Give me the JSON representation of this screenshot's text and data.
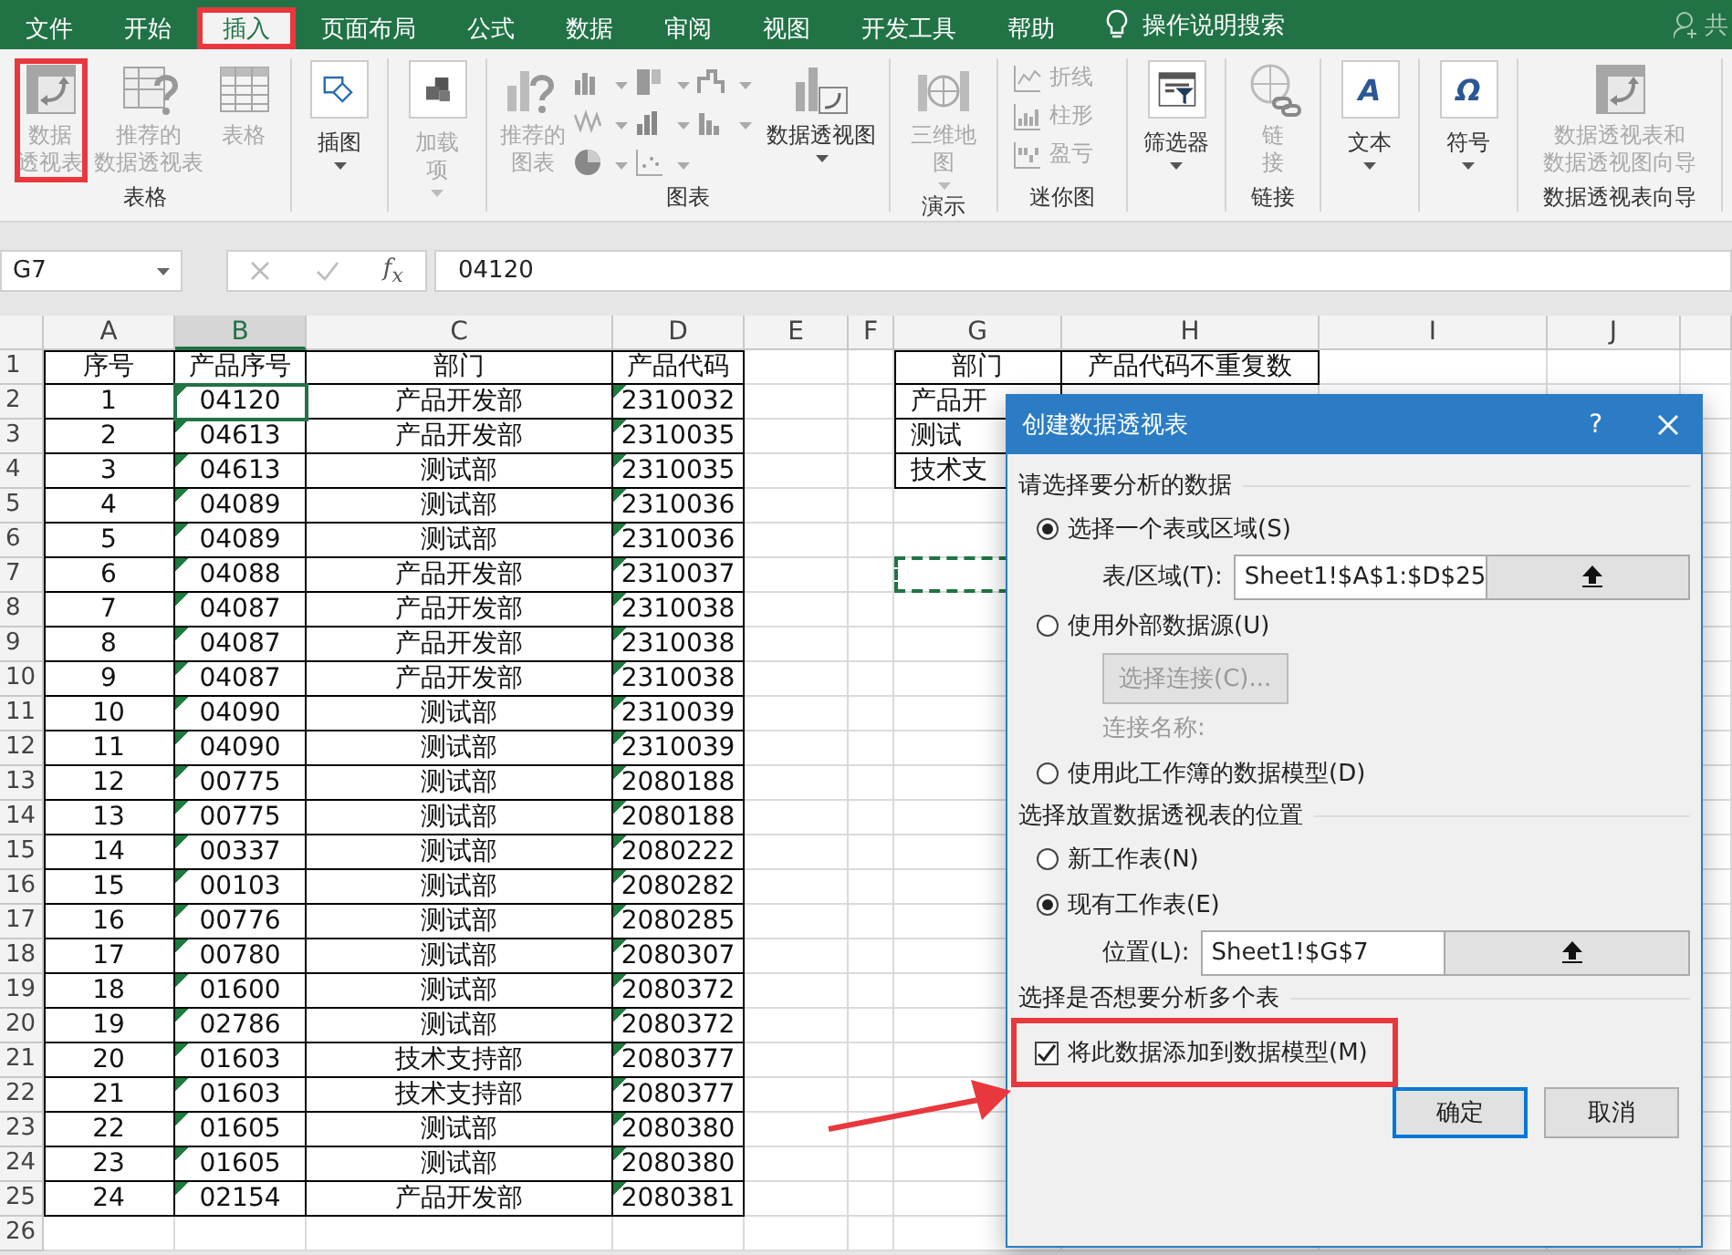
{
  "menu": {
    "tabs": [
      {
        "label": "文件",
        "selected": false
      },
      {
        "label": "开始",
        "selected": false
      },
      {
        "label": "插入",
        "selected": true,
        "annotated": true
      },
      {
        "label": "页面布局",
        "selected": false
      },
      {
        "label": "公式",
        "selected": false
      },
      {
        "label": "数据",
        "selected": false
      },
      {
        "label": "审阅",
        "selected": false
      },
      {
        "label": "视图",
        "selected": false
      },
      {
        "label": "开发工具",
        "selected": false
      },
      {
        "label": "帮助",
        "selected": false
      }
    ],
    "search": "操作说明搜索",
    "share": "共"
  },
  "ribbon": {
    "groups": [
      {
        "label": "表格",
        "items": [
          {
            "kind": "large",
            "lines": [
              "数据",
              "透视表"
            ],
            "disabled": true,
            "annotated": true
          },
          {
            "kind": "large",
            "lines": [
              "推荐的",
              "数据透视表"
            ],
            "disabled": true
          },
          {
            "kind": "large",
            "lines": [
              "表格"
            ],
            "disabled": true
          }
        ]
      },
      {
        "items": [
          {
            "kind": "large",
            "lines": [
              "插图"
            ],
            "disabled": false,
            "dropdown": true,
            "framed": true
          }
        ]
      },
      {
        "items": [
          {
            "kind": "large",
            "lines": [
              "加载",
              "项"
            ],
            "disabled": true,
            "dropdown": true,
            "framed": true
          }
        ]
      },
      {
        "label": "图表",
        "items": [
          {
            "kind": "large",
            "lines": [
              "推荐的",
              "图表"
            ],
            "disabled": true
          },
          {
            "kind": "gallery"
          },
          {
            "kind": "large",
            "lines": [
              "数据透视图"
            ],
            "disabled": false,
            "dropdown": true
          }
        ]
      },
      {
        "label": "演示",
        "items": [
          {
            "kind": "large",
            "lines": [
              "三维地",
              "图"
            ],
            "disabled": true,
            "dropdown": true
          }
        ]
      },
      {
        "label": "迷你图",
        "items": [
          {
            "kind": "small",
            "label": "折线",
            "disabled": true
          },
          {
            "kind": "small",
            "label": "柱形",
            "disabled": true
          },
          {
            "kind": "small",
            "label": "盈亏",
            "disabled": true
          }
        ]
      },
      {
        "items": [
          {
            "kind": "large",
            "lines": [
              "筛选器"
            ],
            "disabled": false,
            "dropdown": true,
            "framed": true
          }
        ]
      },
      {
        "label": "链接",
        "items": [
          {
            "kind": "large",
            "lines": [
              "链",
              "接"
            ],
            "disabled": true
          }
        ]
      },
      {
        "items": [
          {
            "kind": "large",
            "lines": [
              "文本"
            ],
            "glyph": "A",
            "disabled": false,
            "dropdown": true,
            "framed": true
          }
        ]
      },
      {
        "items": [
          {
            "kind": "large",
            "lines": [
              "符号"
            ],
            "glyph": "Ω",
            "disabled": false,
            "dropdown": true,
            "framed": true
          }
        ]
      },
      {
        "label": "数据透视表向导",
        "items": [
          {
            "kind": "large",
            "lines": [
              "数据透视表和",
              "数据透视图向导"
            ],
            "disabled": true
          }
        ]
      }
    ]
  },
  "formula_bar": {
    "name_box": "G7",
    "function_label": "f$_{x}$",
    "formula": "04120"
  },
  "sheet": {
    "columns": [
      {
        "label": "A",
        "selected": false,
        "text_numbers": false
      },
      {
        "label": "B",
        "selected": true,
        "text_numbers": true
      },
      {
        "label": "C",
        "selected": false,
        "text_numbers": false
      },
      {
        "label": "D",
        "selected": false,
        "text_numbers": true
      },
      {
        "label": "E",
        "selected": false
      },
      {
        "label": "F",
        "selected": false
      },
      {
        "label": "G",
        "selected": false
      },
      {
        "label": "H",
        "selected": false
      },
      {
        "label": "I",
        "selected": false
      },
      {
        "label": "J",
        "selected": false
      }
    ],
    "row_headers": [
      "1",
      "2",
      "3",
      "4",
      "5",
      "6",
      "7",
      "8",
      "9",
      "10",
      "11",
      "12",
      "13",
      "14",
      "15",
      "16",
      "17",
      "18",
      "19",
      "20",
      "21",
      "22",
      "23",
      "24",
      "25",
      "26"
    ],
    "active_cell_outline": true,
    "copy_marquee": true,
    "main_table": {
      "rows": [
        [
          "序号",
          "产品序号",
          "部门",
          "产品代码"
        ],
        [
          "1",
          "04120",
          "产品开发部",
          "2310032"
        ],
        [
          "2",
          "04613",
          "产品开发部",
          "2310035"
        ],
        [
          "3",
          "04613",
          "测试部",
          "2310035"
        ],
        [
          "4",
          "04089",
          "测试部",
          "2310036"
        ],
        [
          "5",
          "04089",
          "测试部",
          "2310036"
        ],
        [
          "6",
          "04088",
          "产品开发部",
          "2310037"
        ],
        [
          "7",
          "04087",
          "产品开发部",
          "2310038"
        ],
        [
          "8",
          "04087",
          "产品开发部",
          "2310038"
        ],
        [
          "9",
          "04087",
          "产品开发部",
          "2310038"
        ],
        [
          "10",
          "04090",
          "测试部",
          "2310039"
        ],
        [
          "11",
          "04090",
          "测试部",
          "2310039"
        ],
        [
          "12",
          "00775",
          "测试部",
          "2080188"
        ],
        [
          "13",
          "00775",
          "测试部",
          "2080188"
        ],
        [
          "14",
          "00337",
          "测试部",
          "2080222"
        ],
        [
          "15",
          "00103",
          "测试部",
          "2080282"
        ],
        [
          "16",
          "00776",
          "测试部",
          "2080285"
        ],
        [
          "17",
          "00780",
          "测试部",
          "2080307"
        ],
        [
          "18",
          "01600",
          "测试部",
          "2080372"
        ],
        [
          "19",
          "02786",
          "测试部",
          "2080372"
        ],
        [
          "20",
          "01603",
          "技术支持部",
          "2080377"
        ],
        [
          "21",
          "01603",
          "技术支持部",
          "2080377"
        ],
        [
          "22",
          "01605",
          "测试部",
          "2080380"
        ],
        [
          "23",
          "01605",
          "测试部",
          "2080380"
        ],
        [
          "24",
          "02154",
          "产品开发部",
          "2080381"
        ]
      ]
    },
    "summary_table": {
      "rows": [
        [
          "部门",
          "产品代码不重复数"
        ],
        [
          "产品开"
        ],
        [
          "测试"
        ],
        [
          "技术支"
        ]
      ]
    }
  },
  "dialog": {
    "title": "创建数据透视表",
    "help": "?",
    "sections": [
      {
        "heading": "请选择要分析的数据",
        "items": [
          {
            "kind": "radio",
            "label": "选择一个表或区域(S)",
            "selected": true
          },
          {
            "kind": "field",
            "label": "表/区域(T):",
            "value": "Sheet1!$A$1:$D$25"
          },
          {
            "kind": "radio",
            "label": "使用外部数据源(U)",
            "selected": false
          },
          {
            "kind": "button",
            "label": "选择连接(C)...",
            "disabled": true
          },
          {
            "kind": "note",
            "label": "连接名称:",
            "disabled": true
          },
          {
            "kind": "radio",
            "label": "使用此工作簿的数据模型(D)",
            "selected": false
          }
        ]
      },
      {
        "heading": "选择放置数据透视表的位置",
        "items": [
          {
            "kind": "radio",
            "label": "新工作表(N)",
            "selected": false
          },
          {
            "kind": "radio",
            "label": "现有工作表(E)",
            "selected": true
          },
          {
            "kind": "field",
            "label": "位置(L):",
            "value": "Sheet1!$G$7"
          }
        ]
      },
      {
        "heading": "选择是否想要分析多个表",
        "items": [
          {
            "kind": "checkbox",
            "label": "将此数据添加到数据模型(M)",
            "checked": true,
            "annotated": true
          }
        ]
      }
    ],
    "buttons": [
      {
        "label": "确定",
        "default": true
      },
      {
        "label": "取消",
        "default": false
      }
    ]
  }
}
